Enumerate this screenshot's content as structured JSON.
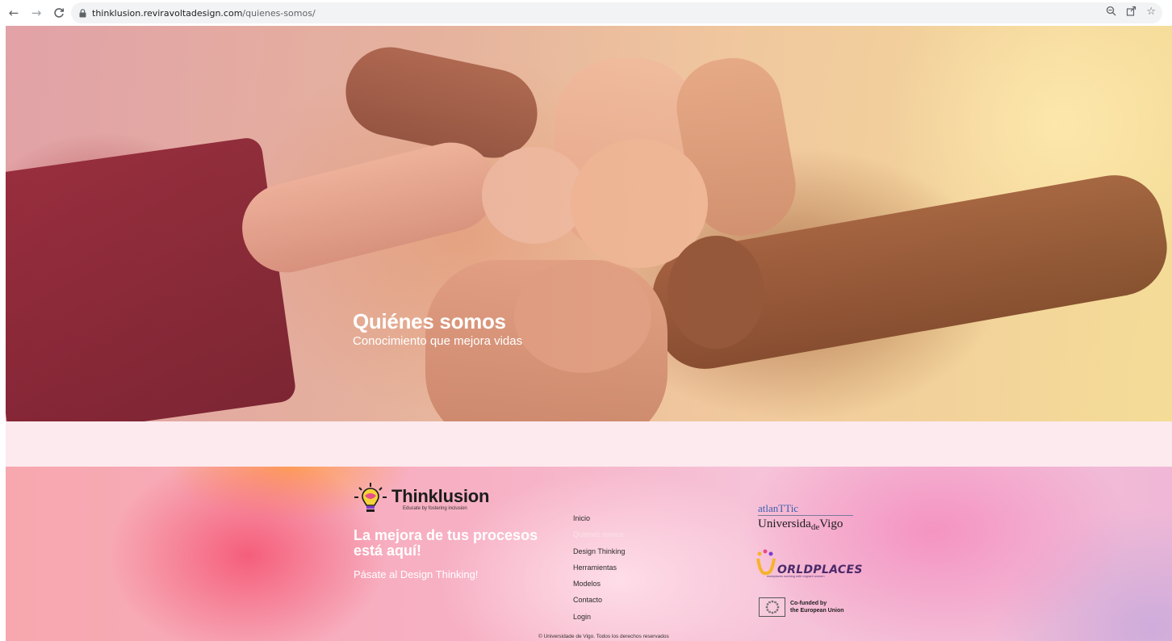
{
  "browser": {
    "url_host": "thinklusion.reviravoltadesign.com",
    "url_path": "/quienes-somos/",
    "icons": [
      "back-arrow-icon",
      "forward-arrow-icon",
      "reload-icon",
      "lock-icon",
      "zoom-icon",
      "share-icon",
      "bookmark-star-icon"
    ]
  },
  "hero": {
    "title": "Quiénes somos",
    "subtitle": "Conocimiento que mejora vidas"
  },
  "footer": {
    "brand_name": "Thinklusion",
    "brand_tagline": "Educate by fostering inclusion",
    "headline": "La mejora de tus procesos está aquí!",
    "cta": "Pásate al Design Thinking!",
    "menu": [
      {
        "label": "Inicio",
        "active": false
      },
      {
        "label": "Quiénes somos",
        "active": true
      },
      {
        "label": "Design Thinking",
        "active": false
      },
      {
        "label": "Herramientas",
        "active": false
      },
      {
        "label": "Modelos",
        "active": false
      },
      {
        "label": "Contacto",
        "active": false
      },
      {
        "label": "Login",
        "active": false
      }
    ],
    "partners": {
      "atlanttic_top": "atlanTTic",
      "atlanttic_univ_a": "Universida",
      "atlanttic_univ_de": "de",
      "atlanttic_univ_b": "Vigo",
      "worldplaces_name": "ORLDPLACES",
      "worldplaces_sub": "workplaces working with migrant women",
      "eu_line1": "Co-funded by",
      "eu_line2": "the European Union"
    },
    "copyright": "© Universidade de Vigo. Todos los derechos reservados"
  },
  "colors": {
    "footer_pink": "#f7b0c4",
    "band_pink": "#fdeaee",
    "accent_white": "#ffffff"
  }
}
